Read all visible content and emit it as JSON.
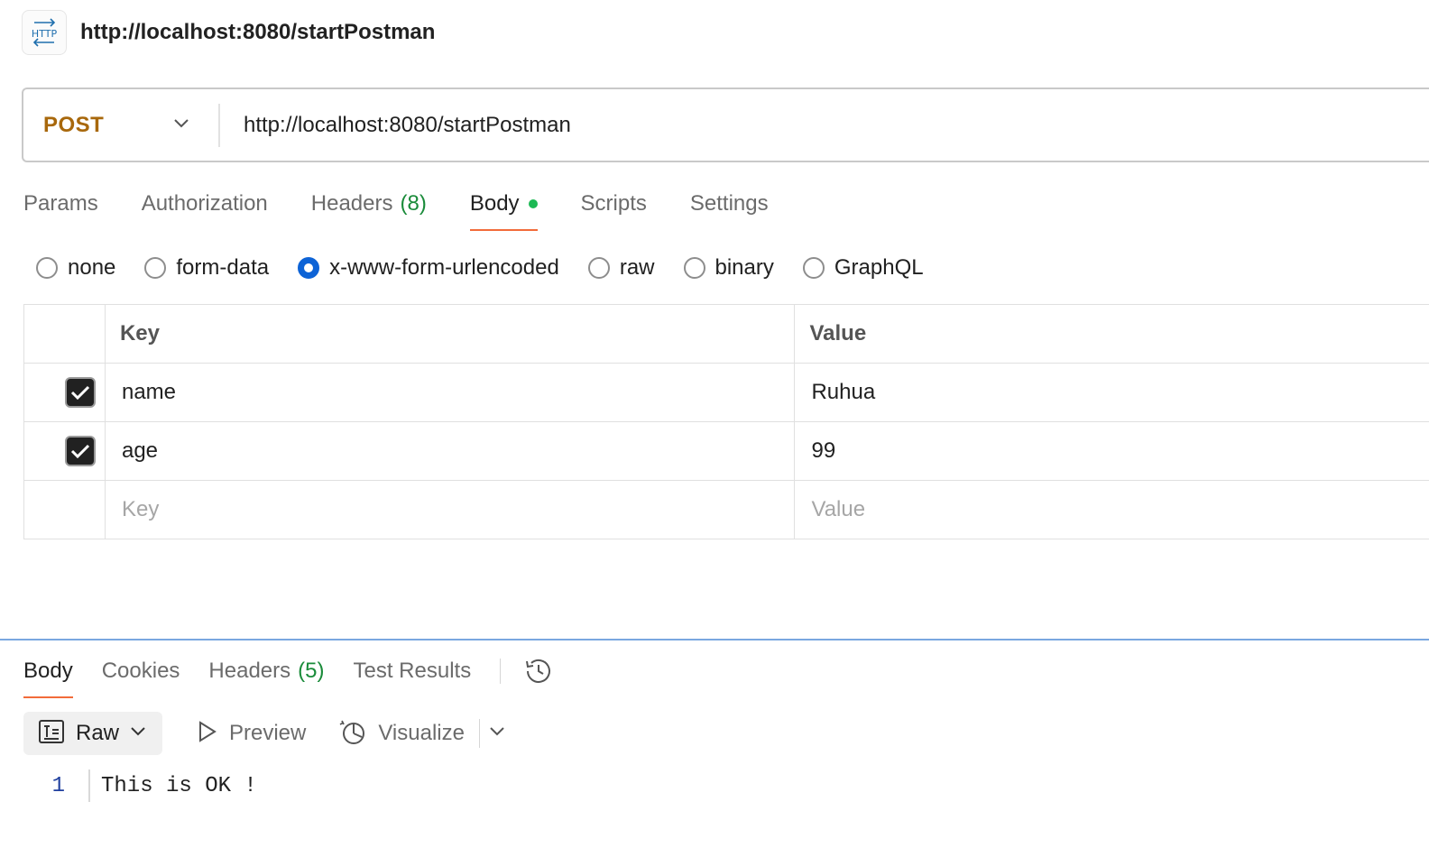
{
  "request": {
    "icon": "http-icon",
    "icon_text": "HTTP",
    "title": "http://localhost:8080/startPostman",
    "method": "POST",
    "url": "http://localhost:8080/startPostman"
  },
  "tabs": [
    {
      "label": "Params"
    },
    {
      "label": "Authorization"
    },
    {
      "label": "Headers",
      "count": "(8)"
    },
    {
      "label": "Body",
      "active": true
    },
    {
      "label": "Scripts"
    },
    {
      "label": "Settings"
    }
  ],
  "body_types": [
    {
      "label": "none",
      "checked": false
    },
    {
      "label": "form-data",
      "checked": false
    },
    {
      "label": "x-www-form-urlencoded",
      "checked": true
    },
    {
      "label": "raw",
      "checked": false
    },
    {
      "label": "binary",
      "checked": false
    },
    {
      "label": "GraphQL",
      "checked": false
    }
  ],
  "kv_table": {
    "headers": {
      "key": "Key",
      "value": "Value"
    },
    "rows": [
      {
        "key": "name",
        "value": "Ruhua",
        "checked": true
      },
      {
        "key": "age",
        "value": "99",
        "checked": true
      }
    ],
    "placeholder": {
      "key": "Key",
      "value": "Value"
    }
  },
  "response": {
    "tabs": [
      {
        "label": "Body",
        "active": true
      },
      {
        "label": "Cookies"
      },
      {
        "label": "Headers",
        "count": "(5)"
      },
      {
        "label": "Test Results"
      }
    ],
    "toolbar": {
      "raw": "Raw",
      "preview": "Preview",
      "visualize": "Visualize"
    },
    "lines": [
      {
        "no": "1",
        "text": "This is OK !"
      }
    ]
  },
  "colors": {
    "method": "#a8680c",
    "accent": "#f26b3a",
    "count": "#1a8b3a",
    "radio_checked": "#0d63d6",
    "divider": "#7aa7e0"
  }
}
